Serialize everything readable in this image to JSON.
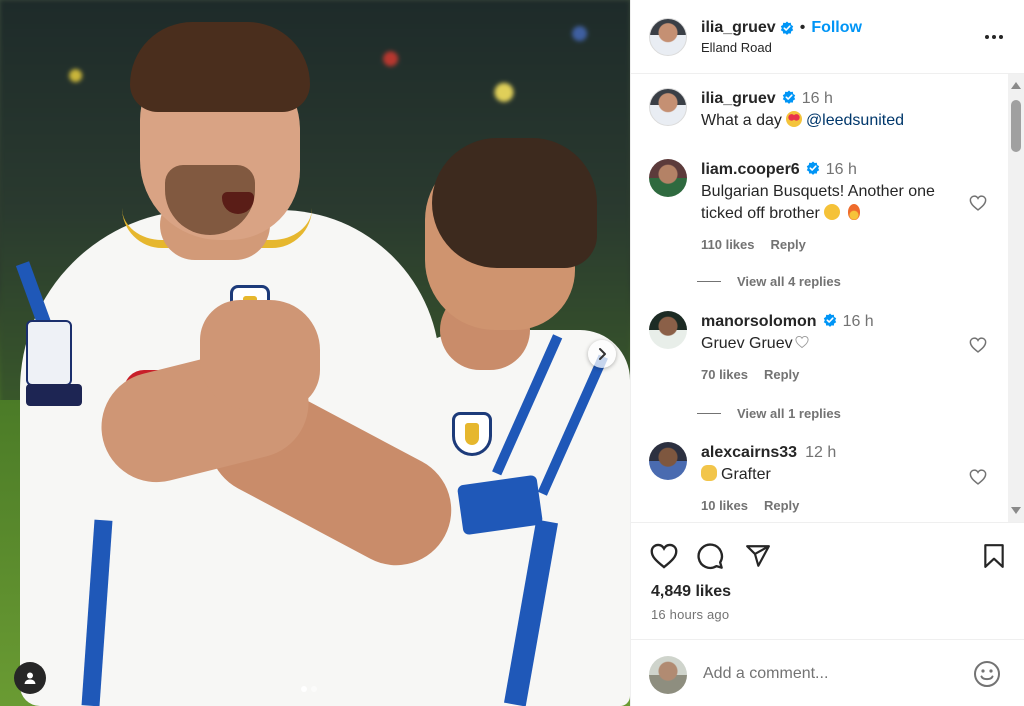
{
  "post": {
    "author": "ilia_gruev",
    "follow_label": "Follow",
    "separator": "•",
    "location": "Elland Road",
    "icons": {
      "more": "more-options-icon",
      "verified": "verified-badge-icon"
    }
  },
  "caption": {
    "author": "ilia_gruev",
    "time": "16 h",
    "text": "What a day",
    "mention": "@leedsunited"
  },
  "comments": [
    {
      "author": "liam.cooper6",
      "time": "16 h",
      "text_line1": "Bulgarian Busquets! Another one",
      "text_line2": "ticked off brother",
      "likes": "110 likes",
      "reply_label": "Reply",
      "view_replies": "View all 4 replies"
    },
    {
      "author": "manorsolomon",
      "time": "16 h",
      "text": "Gruev Gruev",
      "likes": "70 likes",
      "reply_label": "Reply",
      "view_replies": "View all 1 replies"
    },
    {
      "author": "alexcairns33",
      "time": "12 h",
      "text": "Grafter",
      "likes": "10 likes",
      "reply_label": "Reply"
    }
  ],
  "actions": {
    "like_count": "4,849 likes",
    "posted": "16 hours ago",
    "icons": [
      "heart-icon",
      "comment-icon",
      "share-icon",
      "bookmark-icon"
    ]
  },
  "add_comment": {
    "placeholder": "Add a comment..."
  },
  "colors": {
    "accent": "#0095f6",
    "text": "#262626",
    "muted": "#737373",
    "mention": "#00376b",
    "shirt_blue": "#1f58b8",
    "shirt_yellow": "#e6b72e"
  }
}
